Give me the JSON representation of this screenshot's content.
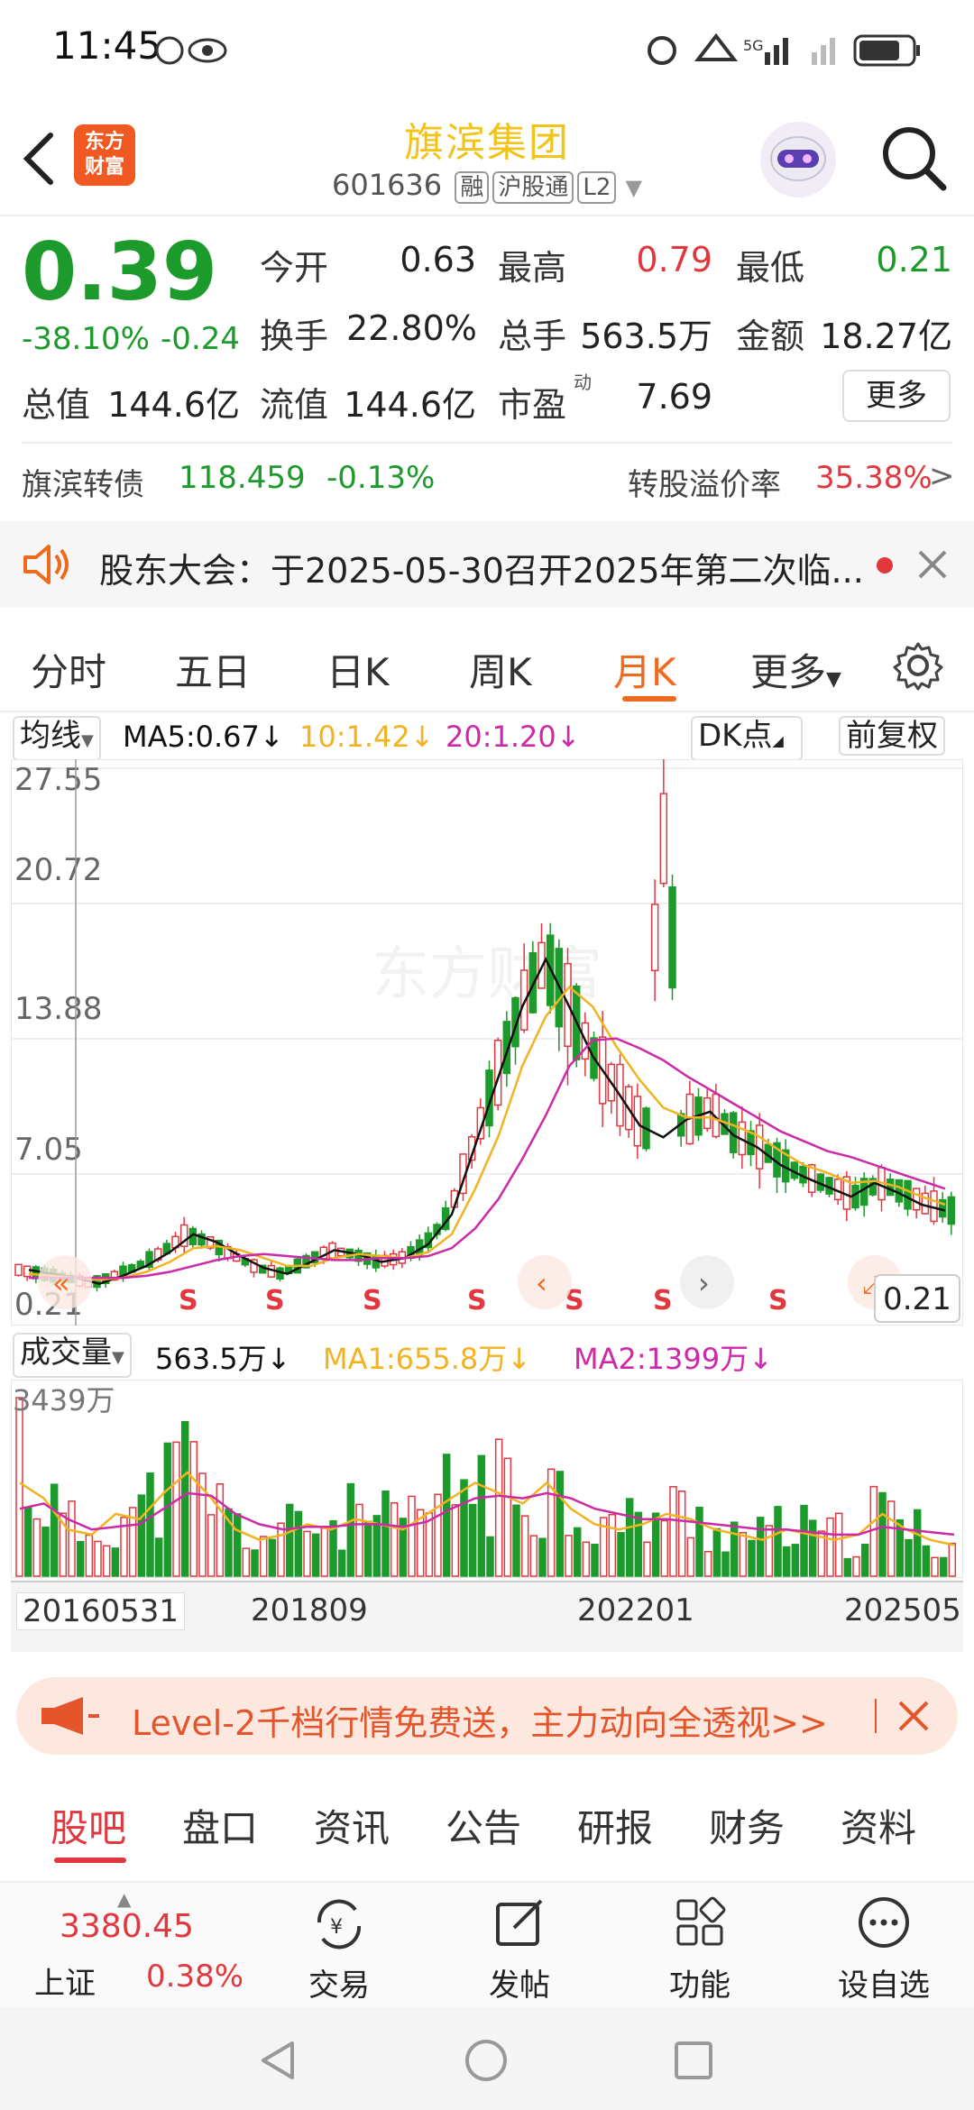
{
  "status_bar": {
    "time": "11:45"
  },
  "header": {
    "logo_text_1": "东方",
    "logo_text_2": "财富",
    "title": "旗滨集团",
    "code": "601636",
    "tags": [
      "融",
      "沪股通",
      "L2"
    ]
  },
  "quote": {
    "price": "0.39",
    "change_pct": "-38.10%",
    "change_abs": "-0.24",
    "open_label": "今开",
    "open": "0.63",
    "high_label": "最高",
    "high": "0.79",
    "low_label": "最低",
    "low": "0.21",
    "turnover_label": "换手",
    "turnover": "22.80%",
    "volume_label": "总手",
    "volume": "563.5万",
    "amount_label": "金额",
    "amount": "18.27亿",
    "mktcap_label": "总值",
    "mktcap": "144.6亿",
    "float_label": "流值",
    "float": "144.6亿",
    "pe_label": "市盈",
    "pe_super": "动",
    "pe": "7.69",
    "more_button": "更多"
  },
  "bond": {
    "name": "旗滨转债",
    "price": "118.459",
    "change": "-0.13%",
    "premium_label": "转股溢价率",
    "premium": "35.38%"
  },
  "notice": {
    "text": "股东大会：于2025-05-30召开2025年第二次临..."
  },
  "kline_tabs": [
    "分时",
    "五日",
    "日K",
    "周K",
    "月K",
    "更多"
  ],
  "ma_bar": {
    "selector": "均线",
    "ma5": "MA5:0.67",
    "ma10": "10:1.42",
    "ma20": "20:1.20",
    "dk_button": "DK点",
    "adjust_button": "前复权"
  },
  "colors": {
    "up": "#e0383e",
    "down": "#1c9a2b",
    "ma5": "#111111",
    "ma10": "#f2b320",
    "ma20": "#cc2aa8",
    "accent": "#f06a1d",
    "title": "#f2c318"
  },
  "volume_bar": {
    "selector": "成交量",
    "value": "563.5万",
    "ma1": "MA1:655.8万",
    "ma2": "MA2:1399万"
  },
  "chart_data": {
    "type": "candlestick",
    "y_ticks": [
      "27.55",
      "20.72",
      "13.88",
      "7.05",
      "0.21"
    ],
    "ylim": [
      0.21,
      27.55
    ],
    "last_low_label": "0.21",
    "volume_max_label": "3439万",
    "x_ticks": [
      "20160531",
      "201809",
      "202201",
      "202505"
    ],
    "s_markers": [
      "S",
      "S",
      "S",
      "S",
      "S",
      "S",
      "S"
    ],
    "watermark": "东方财富",
    "series": [
      {
        "name": "MA5",
        "values": [
          2.2,
          2.0,
          1.8,
          1.5,
          1.9,
          2.4,
          3.1,
          4.0,
          3.6,
          2.9,
          2.3,
          2.0,
          2.6,
          3.2,
          3.0,
          2.6,
          2.8,
          3.5,
          5.0,
          8.5,
          12.0,
          15.5,
          17.9,
          15.5,
          13.0,
          11.3,
          9.5,
          8.9,
          9.8,
          10.2,
          9.0,
          8.4,
          7.5,
          6.9,
          6.4,
          5.9,
          6.6,
          6.1,
          5.5,
          5.2
        ]
      },
      {
        "name": "MA10",
        "values": [
          2.0,
          1.9,
          1.8,
          1.7,
          1.8,
          2.1,
          2.6,
          3.3,
          3.4,
          3.2,
          2.8,
          2.4,
          2.4,
          2.8,
          3.0,
          2.9,
          2.8,
          3.1,
          4.0,
          6.3,
          9.0,
          12.5,
          15.0,
          16.5,
          15.5,
          13.5,
          11.8,
          10.4,
          9.9,
          9.9,
          9.5,
          9.0,
          8.2,
          7.5,
          7.1,
          6.6,
          6.7,
          6.4,
          5.9,
          5.5
        ]
      },
      {
        "name": "MA20",
        "values": [
          1.8,
          1.8,
          1.8,
          1.8,
          1.8,
          1.9,
          2.1,
          2.4,
          2.7,
          2.9,
          3.0,
          2.9,
          2.8,
          2.7,
          2.7,
          2.8,
          2.8,
          2.9,
          3.3,
          4.3,
          5.8,
          7.8,
          10.0,
          12.5,
          13.8,
          13.9,
          13.4,
          12.8,
          12.0,
          11.3,
          10.6,
          9.9,
          9.2,
          8.7,
          8.2,
          7.9,
          7.5,
          7.1,
          6.7,
          6.3
        ]
      },
      {
        "name": "MA1",
        "values": [
          1800,
          1500,
          900,
          800,
          1200,
          1100,
          1600,
          2000,
          1500,
          900,
          700,
          800,
          1000,
          900,
          1100,
          1000,
          900,
          1200,
          1500,
          1800,
          1600,
          1400,
          1800,
          1300,
          1000,
          900,
          1000,
          1200,
          1100,
          900,
          800,
          700,
          900,
          800,
          700,
          800,
          1200,
          900,
          700,
          600
        ]
      },
      {
        "name": "MA2",
        "values": [
          1300,
          1400,
          1100,
          900,
          950,
          1000,
          1300,
          1600,
          1550,
          1200,
          1000,
          900,
          950,
          950,
          1000,
          1000,
          950,
          1050,
          1300,
          1500,
          1550,
          1500,
          1600,
          1500,
          1300,
          1200,
          1100,
          1100,
          1050,
          1000,
          950,
          900,
          900,
          850,
          800,
          800,
          950,
          900,
          850,
          800
        ]
      }
    ]
  },
  "promo": {
    "text": "Level-2千档行情免费送，主力动向全透视>>"
  },
  "bottom_tabs": [
    "股吧",
    "盘口",
    "资讯",
    "公告",
    "研报",
    "财务",
    "资料"
  ],
  "bottom_nav": {
    "index_value": "3380.45",
    "index_name": "上证",
    "index_change": "0.38%",
    "items": [
      "交易",
      "发帖",
      "功能",
      "设自选"
    ]
  }
}
